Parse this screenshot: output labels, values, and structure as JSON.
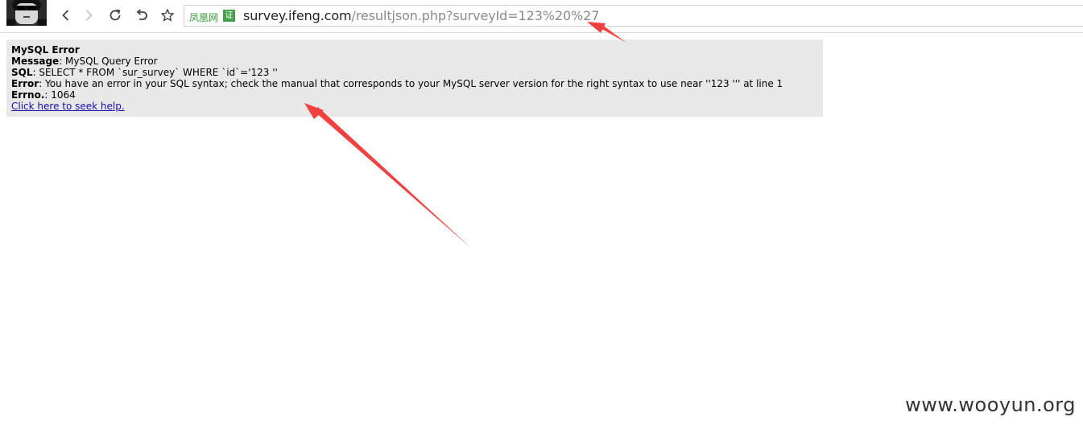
{
  "toolbar": {
    "site_name": "凤凰网",
    "cert_label": "证",
    "url_host": "survey.ifeng.com",
    "url_path": "/resultjson.php?surveyId=123%20%27"
  },
  "error": {
    "title": "MySQL Error",
    "message_label": "Message",
    "message_value": ": MySQL Query Error",
    "sql_label": "SQL",
    "sql_value": ": SELECT * FROM `sur_survey` WHERE `id`='123 ''",
    "error_label": "Error",
    "error_value": ": You have an error in your SQL syntax; check the manual that corresponds to your MySQL server version for the right syntax to use near ''123 ''' at line 1",
    "errno_label": "Errno.",
    "errno_value": ": 1064",
    "help_link": "Click here to seek help."
  },
  "watermark": "www.wooyun.org",
  "colors": {
    "annotation_arrow": "#f04040",
    "error_bg": "#e8e8e8",
    "link": "#1a0dab"
  }
}
